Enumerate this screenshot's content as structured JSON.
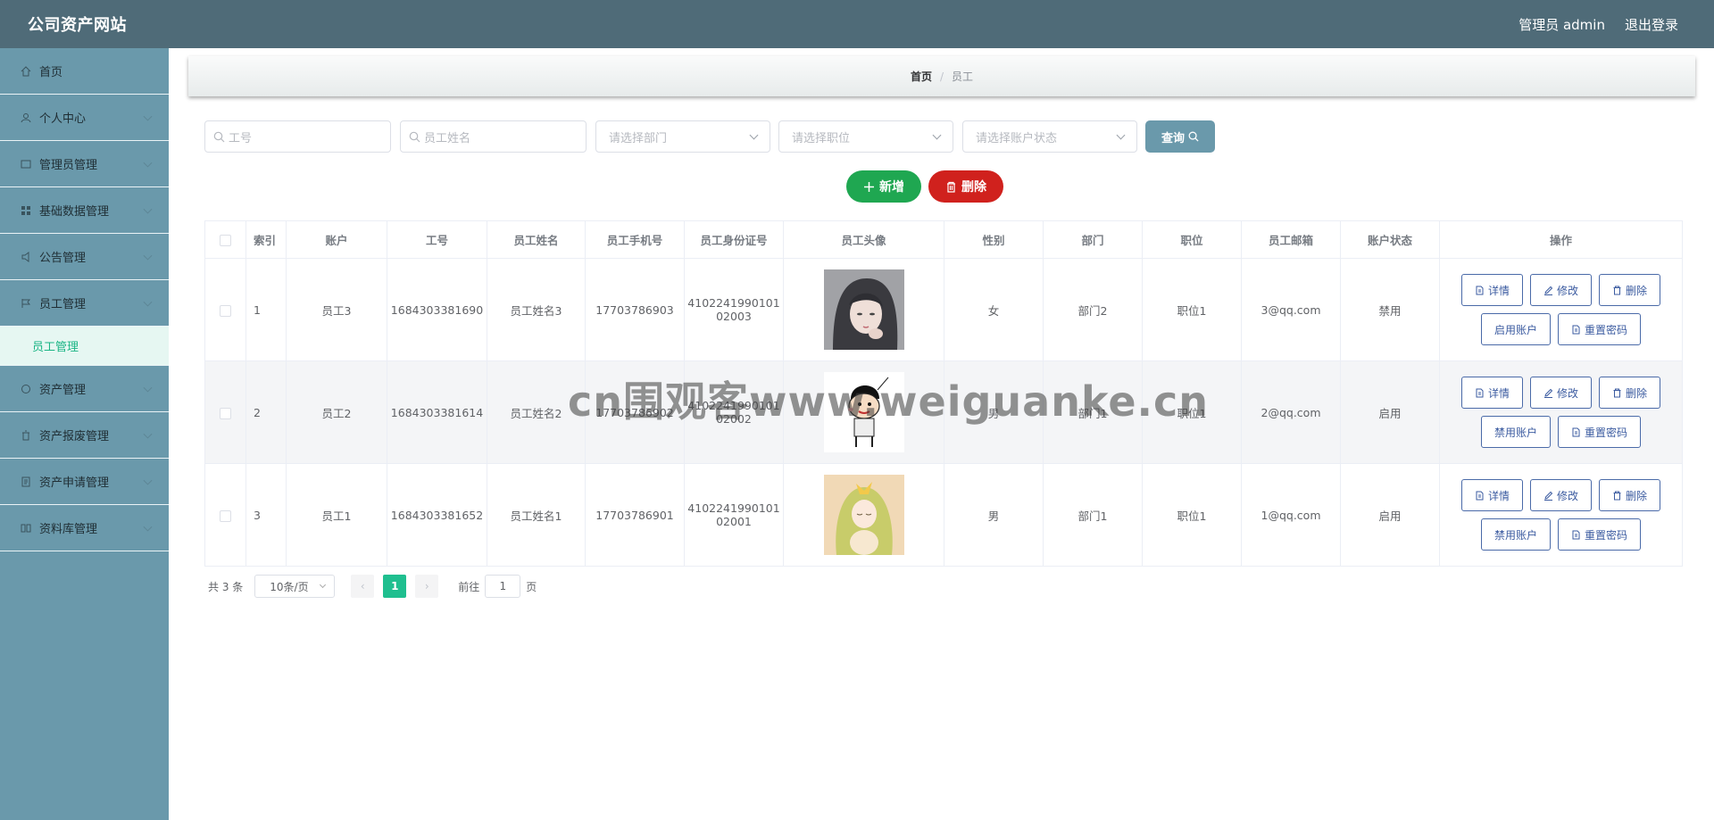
{
  "header": {
    "title": "公司资产网站",
    "user": "管理员 admin",
    "logout": "退出登录"
  },
  "sidebar": {
    "items": [
      {
        "label": "首页",
        "icon": "home-icon"
      },
      {
        "label": "个人中心",
        "icon": "user-icon"
      },
      {
        "label": "管理员管理",
        "icon": "admin-icon"
      },
      {
        "label": "基础数据管理",
        "icon": "data-icon"
      },
      {
        "label": "公告管理",
        "icon": "notice-icon"
      },
      {
        "label": "员工管理",
        "icon": "staff-icon"
      }
    ],
    "active_sub": "员工管理",
    "items_after": [
      {
        "label": "资产管理",
        "icon": "asset-icon"
      },
      {
        "label": "资产报废管理",
        "icon": "scrap-icon"
      },
      {
        "label": "资产申请管理",
        "icon": "apply-icon"
      },
      {
        "label": "资料库管理",
        "icon": "library-icon"
      }
    ]
  },
  "breadcrumb": {
    "home": "首页",
    "separator": "/",
    "current": "员工"
  },
  "filters": {
    "staff_no_placeholder": "工号",
    "staff_name_placeholder": "员工姓名",
    "dept_placeholder": "请选择部门",
    "position_placeholder": "请选择职位",
    "status_placeholder": "请选择账户状态",
    "query_label": "查询"
  },
  "actions": {
    "add_label": "新增",
    "delete_label": "删除"
  },
  "table": {
    "headers": [
      "索引",
      "账户",
      "工号",
      "员工姓名",
      "员工手机号",
      "员工身份证号",
      "员工头像",
      "性别",
      "部门",
      "职位",
      "员工邮箱",
      "账户状态",
      "操作"
    ],
    "rows": [
      {
        "index": "1",
        "account": "员工3",
        "no": "1684303381690",
        "name": "员工姓名3",
        "phone": "17703786903",
        "id1": "4102241990101",
        "id2": "02003",
        "gender": "女",
        "dept": "部门2",
        "position": "职位1",
        "email": "3@qq.com",
        "status": "禁用",
        "toggle": "启用账户"
      },
      {
        "index": "2",
        "account": "员工2",
        "no": "1684303381614",
        "name": "员工姓名2",
        "phone": "17703786902",
        "id1": "4102241990101",
        "id2": "02002",
        "gender": "男",
        "dept": "部门1",
        "position": "职位1",
        "email": "2@qq.com",
        "status": "启用",
        "toggle": "禁用账户"
      },
      {
        "index": "3",
        "account": "员工1",
        "no": "1684303381652",
        "name": "员工姓名1",
        "phone": "17703786901",
        "id1": "4102241990101",
        "id2": "02001",
        "gender": "男",
        "dept": "部门1",
        "position": "职位1",
        "email": "1@qq.com",
        "status": "启用",
        "toggle": "禁用账户"
      }
    ],
    "op_labels": {
      "detail": "详情",
      "edit": "修改",
      "delete": "删除",
      "reset": "重置密码"
    }
  },
  "pagination": {
    "total": "共 3 条",
    "page_size": "10条/页",
    "current_page": "1",
    "goto_prefix": "前往",
    "goto_value": "1",
    "goto_suffix": "页"
  },
  "watermark": "cn围观客www.weiguanke.cn",
  "colors": {
    "header": "#4f6b78",
    "sidebar": "#6a99ab",
    "active": "#1bb585",
    "add": "#1fa751",
    "delete": "#d0211d",
    "op_border": "#4a6aa8"
  }
}
